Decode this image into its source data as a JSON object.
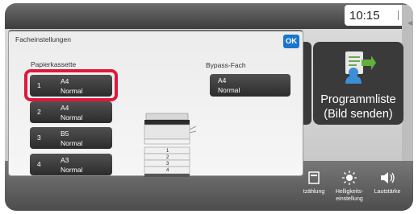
{
  "status_bar": {
    "time": "10:15"
  },
  "home_tiles": {
    "program_list_label": "Programmliste\n(Bild senden)"
  },
  "bottom_bar": {
    "counter_label": "tzählung",
    "brightness_label": "Helligkeits-\neinstellung",
    "volume_label": "Lautstärke"
  },
  "dialog": {
    "title": "Facheinstellungen",
    "ok_label": "OK",
    "paper_tray_heading": "Papierkassette",
    "bypass_heading": "Bypass-Fach",
    "trays": [
      {
        "number": "1",
        "size": "A4",
        "type": "Normal"
      },
      {
        "number": "2",
        "size": "A4",
        "type": "Normal"
      },
      {
        "number": "3",
        "size": "B5",
        "type": "Normal"
      },
      {
        "number": "4",
        "size": "A3",
        "type": "Normal"
      }
    ],
    "bypass": {
      "size": "A4",
      "type": "Normal"
    },
    "printer_tray_numbers": [
      "1",
      "2",
      "3",
      "4"
    ]
  },
  "colors": {
    "highlight": "#e0183a",
    "ok_button": "#1a75cf"
  }
}
